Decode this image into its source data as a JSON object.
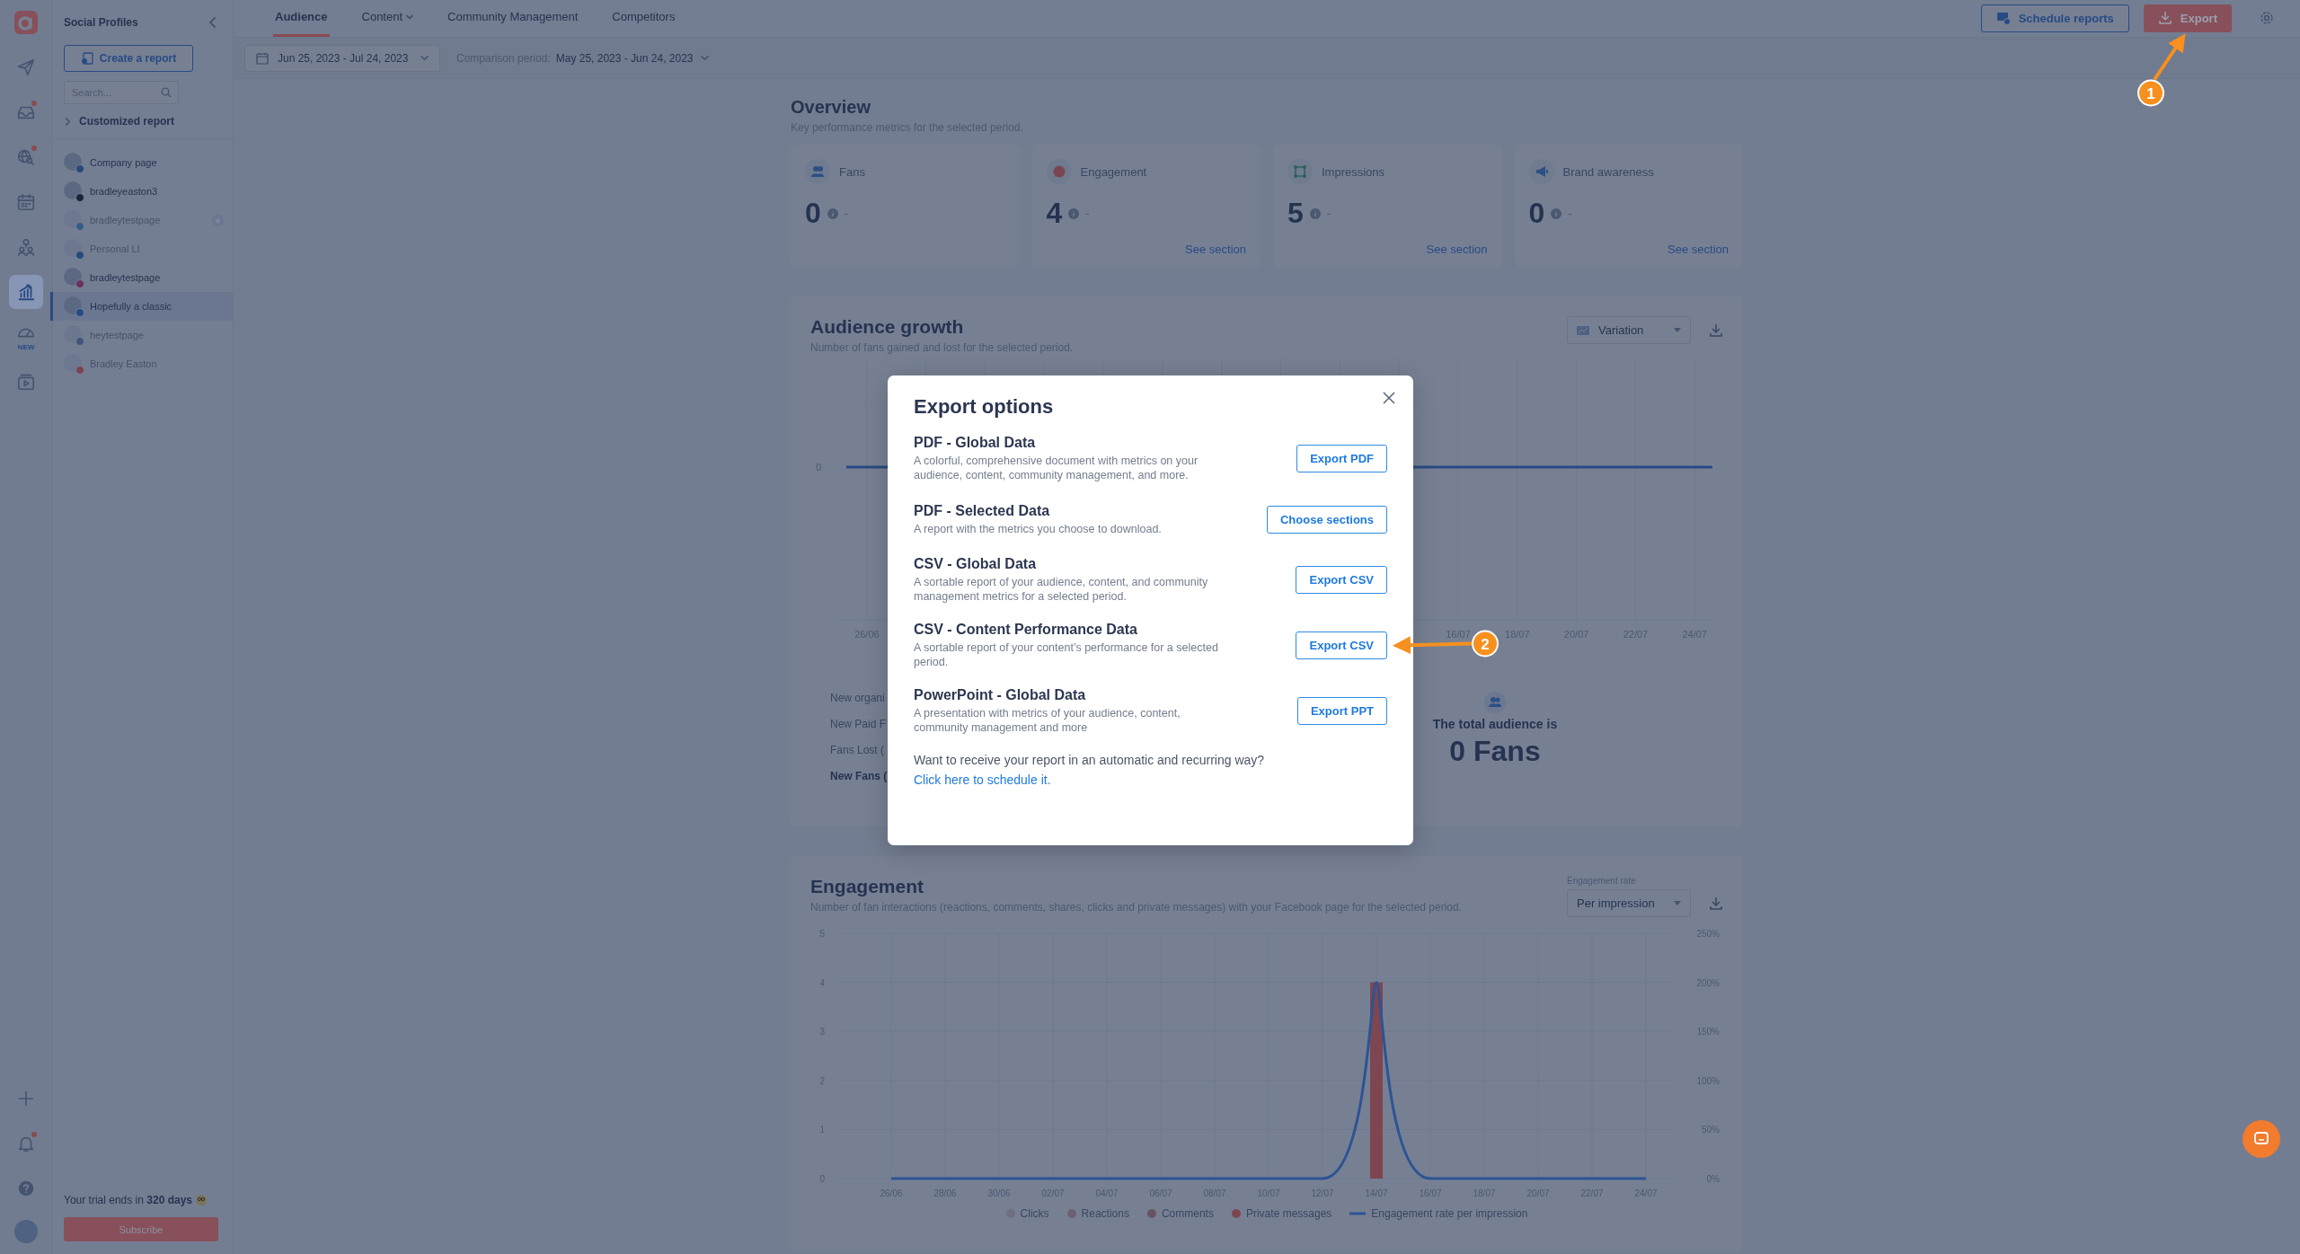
{
  "rail": {
    "items": [
      {
        "selected": false,
        "alert": false
      },
      {
        "selected": false,
        "alert": true
      },
      {
        "selected": false,
        "alert": true
      },
      {
        "selected": false,
        "alert": false
      },
      {
        "selected": false,
        "alert": false
      },
      {
        "selected": true,
        "alert": false
      },
      {
        "selected": false,
        "alert": false,
        "label": "NEW"
      },
      {
        "selected": false,
        "alert": false
      }
    ],
    "bottom_items": [
      {
        "alert": false
      },
      {
        "alert": true
      },
      {
        "alert": false
      }
    ]
  },
  "profiles": {
    "title": "Social Profiles",
    "create_button": "Create a report",
    "search": {
      "placeholder": "Search..."
    },
    "group": {
      "label": "Customized report",
      "expanded": false
    },
    "items": [
      {
        "name": "Company page",
        "color": "#264979",
        "disabled": false,
        "selected": false,
        "starred": false
      },
      {
        "name": "bradleyeaston3",
        "color": "#1c2538",
        "disabled": false,
        "selected": false,
        "starred": false
      },
      {
        "name": "bradleytestpage",
        "color": "#325d8a",
        "disabled": true,
        "selected": false,
        "starred": true
      },
      {
        "name": "Personal LI",
        "color": "#264979",
        "disabled": true,
        "selected": false,
        "starred": false
      },
      {
        "name": "bradleytestpage",
        "color": "#673262",
        "disabled": false,
        "selected": false,
        "starred": false
      },
      {
        "name": "Hopefully a classic",
        "color": "#284a84",
        "disabled": false,
        "selected": true,
        "starred": false
      },
      {
        "name": "heytestpage",
        "color": "#3f557d",
        "disabled": true,
        "selected": false,
        "starred": false
      },
      {
        "name": "Bradley Easton",
        "color": "#7a4553",
        "disabled": true,
        "selected": false,
        "starred": false
      }
    ],
    "trial": "Your trial ends in **320 days**",
    "subscribe": "Subscribe"
  },
  "tabs": [
    {
      "label": "Audience",
      "selected": true,
      "dropdown": false
    },
    {
      "label": "Content",
      "selected": false,
      "dropdown": true
    },
    {
      "label": "Community Management",
      "selected": false,
      "dropdown": false
    },
    {
      "label": "Competitors",
      "selected": false,
      "dropdown": false
    }
  ],
  "actions": {
    "schedule": "Schedule reports",
    "export": "Export"
  },
  "dates": {
    "range": "Jun 25, 2023 - Jul 24, 2023",
    "comparison_label": "Comparison period:",
    "comparison_range": "May 25, 2023 - Jun 24, 2023"
  },
  "overview": {
    "title": "Overview",
    "subtitle": "Key performance metrics for the selected period.",
    "cards": [
      {
        "label": "Fans",
        "value": "0",
        "change": "-"
      },
      {
        "label": "Engagement",
        "value": "4",
        "change": "-",
        "link": "See section"
      },
      {
        "label": "Impressions",
        "value": "5",
        "change": "-",
        "link": "See section"
      },
      {
        "label": "Brand awareness",
        "value": "0",
        "change": "-",
        "link": "See section"
      }
    ]
  },
  "audience_growth": {
    "title": "Audience growth",
    "subtitle": "Number of fans gained and lost for the selected period.",
    "view": "Variation",
    "y_labels": [
      "0"
    ],
    "x_labels_start": [
      "26/06"
    ],
    "x_labels_end": [
      "16/07",
      "18/07",
      "20/07",
      "22/07",
      "24/07"
    ],
    "rows": [
      {
        "text": "New organi",
        "kind": "metric"
      },
      {
        "text": "New Paid F",
        "kind": "metric"
      },
      {
        "text": "Fans Lost (",
        "kind": "metric"
      },
      {
        "text": "New Fans (",
        "kind": "total"
      }
    ],
    "total_label": "The total audience is",
    "total_value": "0 Fans"
  },
  "engagement": {
    "title": "Engagement",
    "subtitle": "Number of fan interactions (reactions, comments, shares, clicks and private messages) with your Facebook page for the selected period.",
    "rate_label": "Engagement rate",
    "rate_value": "Per impression",
    "chart_data": {
      "type": "bar",
      "stacked": true,
      "grid": true,
      "ylim": [
        0,
        5
      ],
      "yticks": [
        0,
        1,
        2,
        3,
        4,
        5
      ],
      "y2lim": [
        0,
        250
      ],
      "y2ticks": [
        {
          "value": 0,
          "label": "0%"
        },
        {
          "value": 50,
          "label": "50%"
        },
        {
          "value": 100,
          "label": "100%"
        },
        {
          "value": 150,
          "label": "150%"
        },
        {
          "value": 200,
          "label": "200%"
        },
        {
          "value": 250,
          "label": "250%"
        }
      ],
      "categories": [
        "26/06",
        "28/06",
        "30/06",
        "02/07",
        "04/07",
        "06/07",
        "08/07",
        "10/07",
        "12/07",
        "14/07",
        "16/07",
        "18/07",
        "20/07",
        "22/07",
        "24/07"
      ],
      "series": [
        {
          "name": "Clicks",
          "color": "#716e81",
          "values": [
            0,
            0,
            0,
            0,
            0,
            0,
            0,
            0,
            0,
            0,
            0,
            0,
            0,
            0,
            0
          ]
        },
        {
          "name": "Reactions",
          "color": "#6d6071",
          "values": [
            0,
            0,
            0,
            0,
            0,
            0,
            0,
            0,
            0,
            0,
            0,
            0,
            0,
            0,
            0
          ]
        },
        {
          "name": "Comments",
          "color": "#685362",
          "values": [
            0,
            0,
            0,
            0,
            0,
            0,
            0,
            0,
            0,
            0,
            0,
            0,
            0,
            0,
            0
          ]
        },
        {
          "name": "Private messages",
          "color": "#7e4650",
          "values": [
            0,
            0,
            0,
            0,
            0,
            0,
            0,
            0,
            0,
            4,
            0,
            0,
            0,
            0,
            0
          ]
        },
        {
          "name": "Engagement rate per impression",
          "color": "#2c5494",
          "type": "line",
          "axis": "y2",
          "values": [
            0,
            0,
            0,
            0,
            0,
            0,
            0,
            0,
            0,
            200,
            0,
            0,
            0,
            0,
            0
          ]
        }
      ]
    }
  },
  "modal": {
    "title": "Export options",
    "options": [
      {
        "title": "PDF - Global Data",
        "description": "A colorful, comprehensive document with metrics on your audience, content, community management, and more.",
        "button": "Export PDF"
      },
      {
        "title": "PDF - Selected Data",
        "description": "A report with the metrics you choose to download.",
        "button": "Choose sections"
      },
      {
        "title": "CSV - Global Data",
        "description": "A sortable report of your audience, content, and community management metrics for a selected period.",
        "button": "Export CSV"
      },
      {
        "title": "CSV - Content Performance Data",
        "description": "A sortable report of your content’s performance for a selected period.",
        "button": "Export CSV"
      },
      {
        "title": "PowerPoint - Global Data",
        "description": "A presentation with metrics of your audience, content, community management and more",
        "button": "Export PPT"
      }
    ],
    "footer": "Want to receive your report in an automatic and recurring way?",
    "link": "Click here to schedule it."
  },
  "annotations": [
    {
      "label": "1"
    },
    {
      "label": "2"
    }
  ]
}
